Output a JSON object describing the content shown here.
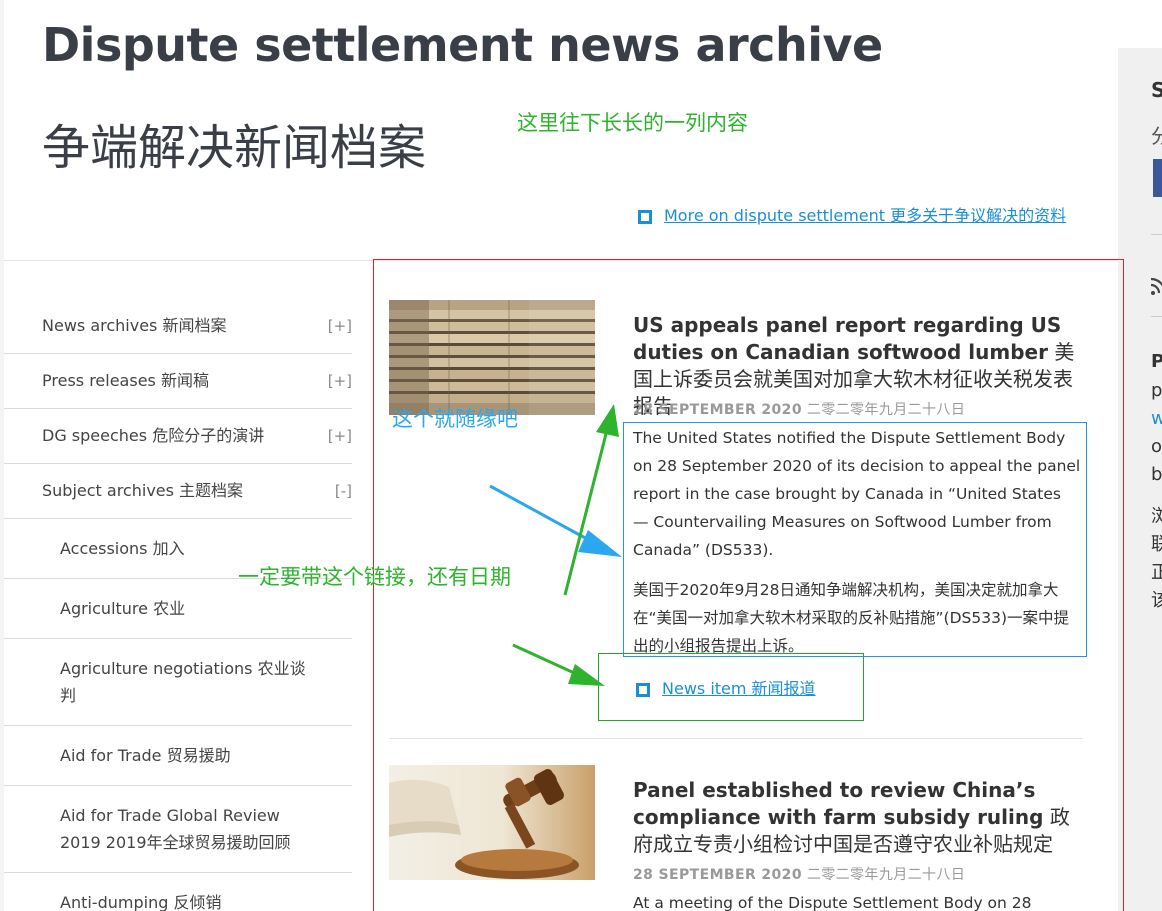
{
  "header": {
    "title": "Dispute settlement news archive",
    "subtitle": "争端解决新闻档案"
  },
  "more_link": {
    "icon": "square-bullet-icon",
    "label": "More on dispute settlement 更多关于争议解决的资料"
  },
  "sidebar": {
    "items": [
      {
        "label": "News archives 新闻档案",
        "toggle": "[+]"
      },
      {
        "label": "Press releases 新闻稿",
        "toggle": "[+]"
      },
      {
        "label": "DG speeches 危险分子的演讲",
        "toggle": "[+]"
      },
      {
        "label": "Subject archives 主题档案",
        "toggle": "[-]"
      }
    ],
    "sub_items": [
      {
        "label": "Accessions 加入"
      },
      {
        "label": "Agriculture 农业"
      },
      {
        "label": "Agriculture negotiations 农业谈判"
      },
      {
        "label": "Aid for Trade 贸易援助"
      },
      {
        "label": "Aid for Trade Global Review 2019 2019年全球贸易援助回顾"
      },
      {
        "label": "Anti-dumping 反倾销"
      }
    ]
  },
  "news": [
    {
      "image": "stacked-lumber-photo",
      "title_en": "US appeals panel report regarding US duties on Canadian softwood lumber",
      "title_cn": "美国上诉委员会就美国对加拿大软木材征收关税发表报告",
      "date_en": "28 SEPTEMBER 2020",
      "date_cn": "二零二零年九月二十八日",
      "body_en": "The United States notified the Dispute Settlement Body on 28 September 2020 of its decision to appeal the panel report in the case brought by Canada in “United States — Countervailing Measures on Softwood Lumber from Canada” (DS533).",
      "body_cn": "美国于2020年9月28日通知争端解决机构，美国决定就加拿大在“美国一对加拿大软木材采取的反补贴措施”(DS533)一案中提出的小组报告提出上诉。",
      "link_label": "News item 新闻报道"
    },
    {
      "image": "gavel-photo",
      "title_en": "Panel established to review China’s compliance with farm subsidy ruling",
      "title_cn": "政府成立专责小组检讨中国是否遵守农业补贴规定",
      "date_en": "28 SEPTEMBER 2020",
      "date_cn": "二零二零年九月二十八日",
      "body_en": "At a meeting of the Dispute Settlement Body on 28"
    }
  ],
  "annotations": {
    "top": "这里往下长长的一列内容",
    "image_note": "这个就随缘吧",
    "link_note": "一定要带这个链接，还有日期",
    "colors": {
      "green": "#2db32d",
      "blue": "#2aa7ef",
      "red": "#e0202a"
    }
  },
  "right_column": {
    "heading_initial": "S",
    "cn_initial": "分",
    "rss_icon": "rss-icon",
    "text_initials": [
      "P",
      "p",
      "w",
      "o",
      "b"
    ],
    "cn_initials": [
      "浏",
      "联",
      "正",
      "该"
    ]
  },
  "colors": {
    "link": "#1a8fd6",
    "title": "#3a3f47",
    "date": "#999999"
  }
}
